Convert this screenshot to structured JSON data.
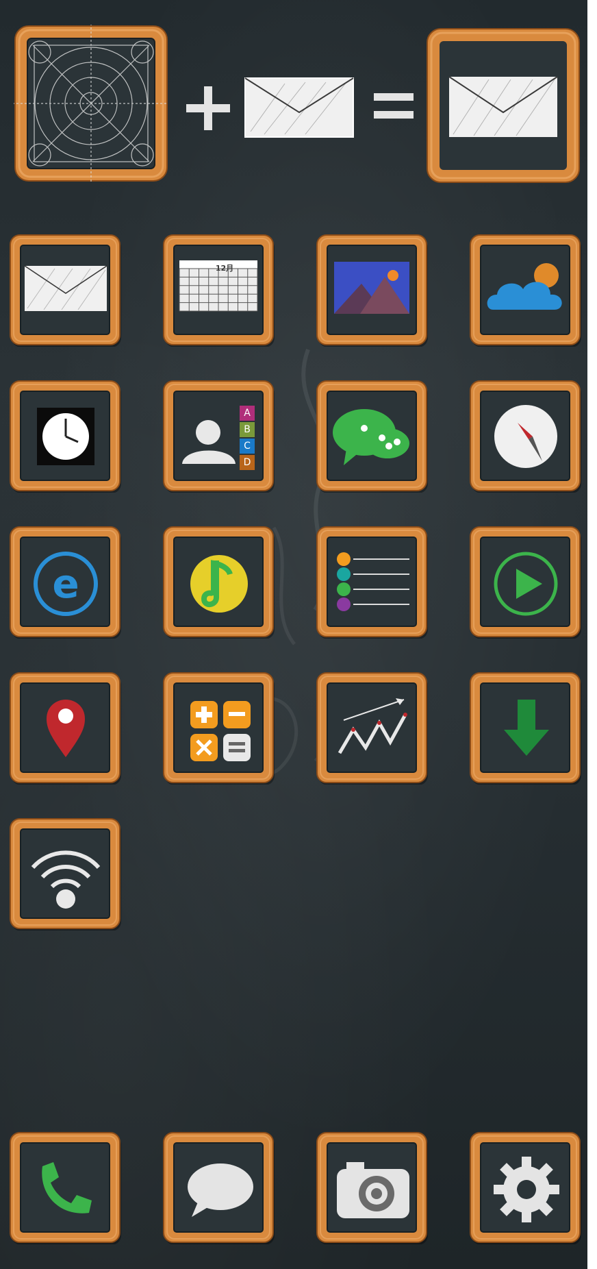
{
  "title": "",
  "icons": {
    "header_template": "grid-template-icon",
    "plus": "plus-sign",
    "header_mail": "mail-icon",
    "equals": "equals-sign",
    "header_result": "mail-icon",
    "grid": [
      "mail-icon",
      "calendar-icon",
      "photos-icon",
      "weather-icon",
      "clock-icon",
      "contacts-icon",
      "chat-icon",
      "compass-icon",
      "browser-icon",
      "music-icon",
      "list-icon",
      "play-icon",
      "map-pin-icon",
      "calculator-icon",
      "stocks-icon",
      "download-icon",
      "wifi-icon"
    ],
    "dock": [
      "phone-icon",
      "messages-icon",
      "camera-icon",
      "settings-icon"
    ]
  },
  "calendar": {
    "header": "12月"
  },
  "contacts": {
    "letters": [
      "A",
      "B",
      "C",
      "D"
    ]
  },
  "colors": {
    "board": "#262e32",
    "frame": "#d98a3e",
    "frame_dark": "#a85f1f",
    "chalk": "#e8e8e8",
    "mail_blue": "#2a8fd6",
    "green": "#3cb44b",
    "red": "#c0282d",
    "orange": "#f39c1f",
    "purple": "#8a3aa0",
    "teal": "#1aa6a0"
  }
}
